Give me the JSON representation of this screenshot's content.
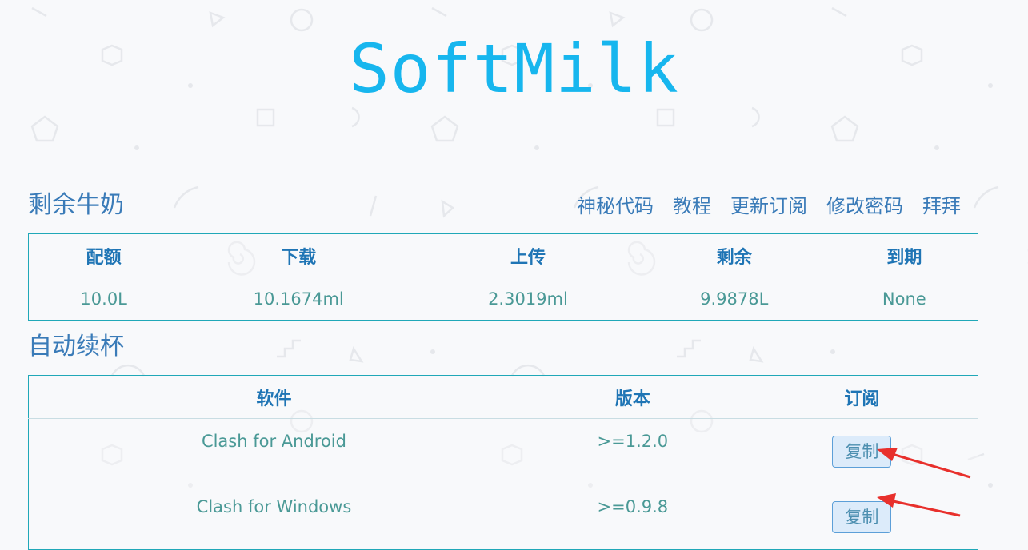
{
  "header": {
    "logo": "SoftMilk"
  },
  "quota_section": {
    "title": "剩余牛奶",
    "nav": [
      "神秘代码",
      "教程",
      "更新订阅",
      "修改密码",
      "拜拜"
    ],
    "columns": [
      "配额",
      "下载",
      "上传",
      "剩余",
      "到期"
    ],
    "row": [
      "10.0L",
      "10.1674ml",
      "2.3019ml",
      "9.9878L",
      "None"
    ]
  },
  "renew_section": {
    "title": "自动续杯",
    "columns": [
      "软件",
      "版本",
      "订阅"
    ],
    "rows": [
      {
        "software": "Clash for Android",
        "version": ">=1.2.0",
        "action": "复制"
      },
      {
        "software": "Clash for Windows",
        "version": ">=0.9.8",
        "action": "复制"
      }
    ]
  },
  "colors": {
    "logo": "#17b6ee",
    "section_title": "#3a7bb8",
    "table_border": "#20a8b8",
    "header_text": "#1f75b5",
    "cell_text": "#4a9996",
    "annotation_arrow": "#e8302c"
  }
}
